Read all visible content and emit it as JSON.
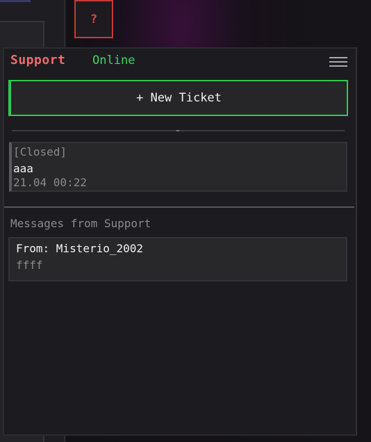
{
  "help_button": {
    "label": "?",
    "color": "#e04545"
  },
  "panel": {
    "title": "Support",
    "title_color": "#f26b6b",
    "status": "Online",
    "status_color": "#3bd662",
    "menu_icon": "hamburger-menu-icon"
  },
  "new_ticket": {
    "label": "+ New Ticket",
    "accent_color": "#32c94e"
  },
  "tickets": [
    {
      "status": "[Closed]",
      "subject": "aaa",
      "date": "21.04 00:22"
    }
  ],
  "messages_section": {
    "title": "Messages from Support",
    "items": [
      {
        "from": "From: Misterio_2002",
        "body": "ffff"
      }
    ]
  }
}
